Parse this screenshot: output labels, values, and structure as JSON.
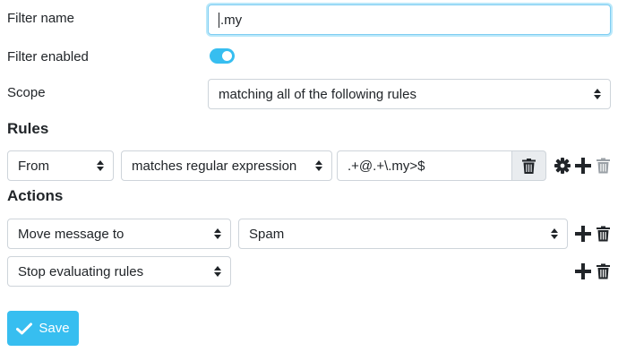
{
  "form": {
    "filter_name_label": "Filter name",
    "filter_name_value": ".my",
    "filter_enabled_label": "Filter enabled",
    "filter_enabled": true,
    "scope_label": "Scope",
    "scope_value": "matching all of the following rules"
  },
  "rules": {
    "heading": "Rules",
    "items": [
      {
        "header": "From",
        "operator": "matches regular expression",
        "value": ".+@.+\\.my>$"
      }
    ]
  },
  "actions": {
    "heading": "Actions",
    "items": [
      {
        "type": "Move message to",
        "target": "Spam"
      },
      {
        "type": "Stop evaluating rules"
      }
    ]
  },
  "save_label": "Save",
  "colors": {
    "accent": "#37bef0",
    "focus_border": "#7fcdf2"
  },
  "icons": [
    "trash-icon",
    "gear-icon",
    "plus-icon",
    "check-icon",
    "select-caret-icon"
  ]
}
